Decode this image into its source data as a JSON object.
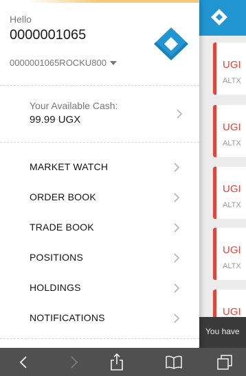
{
  "drawer": {
    "greeting": "Hello",
    "user_name": "0000001065",
    "account_id": "0000001065ROCKU800",
    "cash": {
      "label": "Your Available Cash:",
      "value": "99.99 UGX"
    },
    "menu": [
      {
        "label": "MARKET WATCH"
      },
      {
        "label": "ORDER BOOK"
      },
      {
        "label": "TRADE BOOK"
      },
      {
        "label": "POSITIONS"
      },
      {
        "label": "HOLDINGS"
      },
      {
        "label": "NOTIFICATIONS"
      }
    ]
  },
  "background_app": {
    "cards": [
      {
        "code": "UGI",
        "sub": "ALTX"
      },
      {
        "code": "UGI",
        "sub": "ALTX"
      },
      {
        "code": "UGI",
        "sub": "ALTX"
      },
      {
        "code": "UGI",
        "sub": "ALTX"
      },
      {
        "code": "UGI",
        "sub": ""
      }
    ],
    "toast": "You have"
  },
  "colors": {
    "brand_blue": "#2196d3",
    "accent_red": "#e2453c",
    "toolbar_gray": "#505050"
  },
  "icons": {
    "brand": "diamond-logo-icon",
    "account_dropdown": "caret-down-icon",
    "row_chevron": "chevron-right-icon",
    "toolbar": [
      "back-icon",
      "forward-icon",
      "share-icon",
      "bookmarks-icon",
      "tabs-icon"
    ]
  }
}
